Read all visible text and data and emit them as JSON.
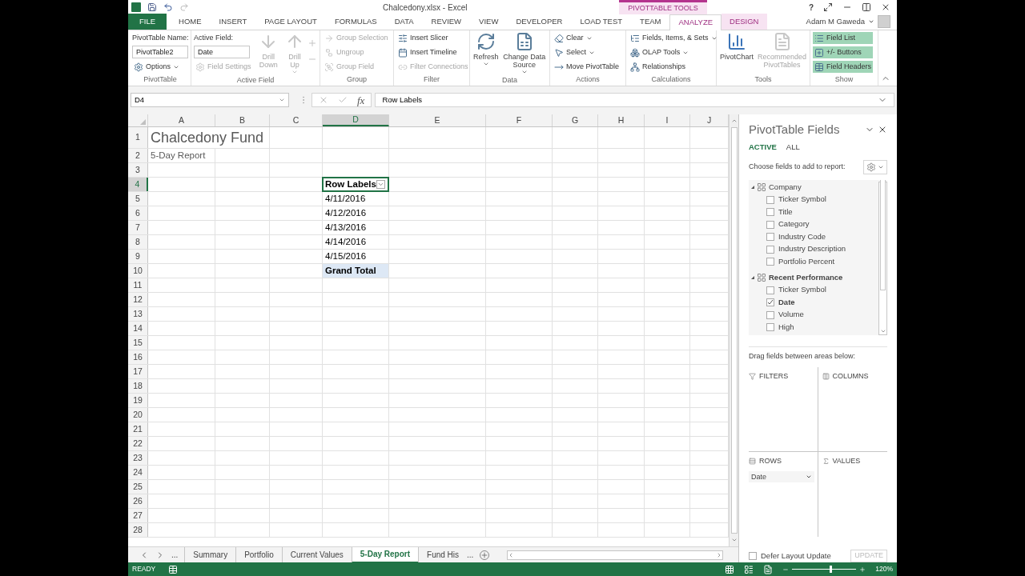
{
  "title_bar": {
    "title": "Chalcedony.xlsx - Excel",
    "contextual_tab_group": "PIVOTTABLE TOOLS",
    "help": "?",
    "user": "Adam M Gaweda"
  },
  "ribbon_tabs": [
    {
      "label": "FILE",
      "kind": "file",
      "selected": false
    },
    {
      "label": "HOME",
      "kind": "tab",
      "selected": false
    },
    {
      "label": "INSERT",
      "kind": "tab",
      "selected": false
    },
    {
      "label": "PAGE LAYOUT",
      "kind": "tab",
      "selected": false
    },
    {
      "label": "FORMULAS",
      "kind": "tab",
      "selected": false
    },
    {
      "label": "DATA",
      "kind": "tab",
      "selected": false
    },
    {
      "label": "REVIEW",
      "kind": "tab",
      "selected": false
    },
    {
      "label": "VIEW",
      "kind": "tab",
      "selected": false
    },
    {
      "label": "DEVELOPER",
      "kind": "tab",
      "selected": false
    },
    {
      "label": "LOAD TEST",
      "kind": "tab",
      "selected": false
    },
    {
      "label": "TEAM",
      "kind": "tab",
      "selected": false
    },
    {
      "label": "ANALYZE",
      "kind": "contextual",
      "selected": true
    },
    {
      "label": "DESIGN",
      "kind": "contextual",
      "selected": false
    }
  ],
  "ribbon_groups": [
    {
      "label": "PivotTable",
      "items": [
        {
          "kind": "caption",
          "label": "PivotTable Name:"
        },
        {
          "kind": "field",
          "value": "PivotTable2"
        },
        {
          "kind": "small",
          "label": "Options",
          "disabled": false,
          "dropdown": true,
          "on": false
        }
      ]
    },
    {
      "label": "Active Field",
      "items": [
        {
          "kind": "caption",
          "label": "Active Field:"
        },
        {
          "kind": "field",
          "value": "Date"
        },
        {
          "kind": "small",
          "label": "Field Settings",
          "disabled": true,
          "dropdown": false,
          "on": false
        },
        {
          "kind": "large",
          "label": "Drill Down",
          "disabled": true,
          "dropdown": false
        },
        {
          "kind": "large",
          "label": "Drill Up",
          "disabled": true,
          "dropdown": true
        },
        {
          "kind": "tiny",
          "disabled": true
        }
      ]
    },
    {
      "label": "Group",
      "items": [
        {
          "kind": "small",
          "label": "Group Selection",
          "disabled": true,
          "dropdown": false,
          "on": false
        },
        {
          "kind": "small",
          "label": "Ungroup",
          "disabled": true,
          "dropdown": false,
          "on": false
        },
        {
          "kind": "small",
          "label": "Group Field",
          "disabled": true,
          "dropdown": false,
          "on": false
        }
      ]
    },
    {
      "label": "Filter",
      "items": [
        {
          "kind": "small",
          "label": "Insert Slicer",
          "disabled": false,
          "dropdown": false,
          "on": false
        },
        {
          "kind": "small",
          "label": "Insert Timeline",
          "disabled": false,
          "dropdown": false,
          "on": false
        },
        {
          "kind": "small",
          "label": "Filter Connections",
          "disabled": true,
          "dropdown": false,
          "on": false
        }
      ]
    },
    {
      "label": "Data",
      "items": [
        {
          "kind": "large",
          "label": "Refresh",
          "disabled": false,
          "dropdown": true
        },
        {
          "kind": "large",
          "label": "Change Data Source",
          "disabled": false,
          "dropdown": true
        }
      ]
    },
    {
      "label": "Actions",
      "items": [
        {
          "kind": "small",
          "label": "Clear",
          "disabled": false,
          "dropdown": true,
          "on": false
        },
        {
          "kind": "small",
          "label": "Select",
          "disabled": false,
          "dropdown": true,
          "on": false
        },
        {
          "kind": "small",
          "label": "Move PivotTable",
          "disabled": false,
          "dropdown": false,
          "on": false
        }
      ]
    },
    {
      "label": "Calculations",
      "items": [
        {
          "kind": "small",
          "label": "Fields, Items, & Sets",
          "disabled": false,
          "dropdown": true,
          "on": false
        },
        {
          "kind": "small",
          "label": "OLAP Tools",
          "disabled": false,
          "dropdown": true,
          "on": false
        },
        {
          "kind": "small",
          "label": "Relationships",
          "disabled": false,
          "dropdown": false,
          "on": false
        }
      ]
    },
    {
      "label": "Tools",
      "items": [
        {
          "kind": "large",
          "label": "PivotChart",
          "disabled": false,
          "dropdown": false
        },
        {
          "kind": "large",
          "label": "Recommended PivotTables",
          "disabled": true,
          "dropdown": false
        }
      ]
    },
    {
      "label": "Show",
      "items": [
        {
          "kind": "small",
          "label": "Field List",
          "disabled": false,
          "dropdown": false,
          "on": true
        },
        {
          "kind": "small",
          "label": "+/- Buttons",
          "disabled": false,
          "dropdown": false,
          "on": true
        },
        {
          "kind": "small",
          "label": "Field Headers",
          "disabled": false,
          "dropdown": false,
          "on": true
        }
      ]
    }
  ],
  "formula_bar": {
    "name_box": "D4",
    "function_button": "fx",
    "formula": "Row Labels"
  },
  "sheet": {
    "columns": [
      {
        "label": "A",
        "selected": false
      },
      {
        "label": "B",
        "selected": false
      },
      {
        "label": "C",
        "selected": false
      },
      {
        "label": "D",
        "selected": true
      },
      {
        "label": "E",
        "selected": false
      },
      {
        "label": "F",
        "selected": false
      },
      {
        "label": "G",
        "selected": false
      },
      {
        "label": "H",
        "selected": false
      },
      {
        "label": "I",
        "selected": false
      },
      {
        "label": "J",
        "selected": false
      }
    ],
    "rows": [
      {
        "number": "1",
        "selected": false,
        "cells": [
          {
            "kind": "title",
            "text": "Chalcedony Fund"
          }
        ]
      },
      {
        "number": "2",
        "selected": false,
        "cells": [
          {
            "kind": "subtitle",
            "text": "5-Day Report"
          }
        ]
      },
      {
        "number": "3",
        "selected": false,
        "cells": []
      },
      {
        "number": "4",
        "selected": true,
        "cells": [
          {
            "kind": "pivot_header",
            "text": "Row Labels"
          }
        ]
      },
      {
        "number": "5",
        "selected": false,
        "cells": [
          {
            "kind": "pivot_item",
            "text": "4/11/2016"
          }
        ]
      },
      {
        "number": "6",
        "selected": false,
        "cells": [
          {
            "kind": "pivot_item",
            "text": "4/12/2016"
          }
        ]
      },
      {
        "number": "7",
        "selected": false,
        "cells": [
          {
            "kind": "pivot_item",
            "text": "4/13/2016"
          }
        ]
      },
      {
        "number": "8",
        "selected": false,
        "cells": [
          {
            "kind": "pivot_item",
            "text": "4/14/2016"
          }
        ]
      },
      {
        "number": "9",
        "selected": false,
        "cells": [
          {
            "kind": "pivot_item",
            "text": "4/15/2016"
          }
        ]
      },
      {
        "number": "10",
        "selected": false,
        "cells": [
          {
            "kind": "pivot_total",
            "text": "Grand Total"
          }
        ]
      },
      {
        "number": "11",
        "selected": false,
        "cells": []
      },
      {
        "number": "12",
        "selected": false,
        "cells": []
      },
      {
        "number": "13",
        "selected": false,
        "cells": []
      },
      {
        "number": "14",
        "selected": false,
        "cells": []
      },
      {
        "number": "15",
        "selected": false,
        "cells": []
      },
      {
        "number": "16",
        "selected": false,
        "cells": []
      },
      {
        "number": "17",
        "selected": false,
        "cells": []
      },
      {
        "number": "18",
        "selected": false,
        "cells": []
      },
      {
        "number": "19",
        "selected": false,
        "cells": []
      },
      {
        "number": "20",
        "selected": false,
        "cells": []
      },
      {
        "number": "21",
        "selected": false,
        "cells": []
      },
      {
        "number": "22",
        "selected": false,
        "cells": []
      },
      {
        "number": "23",
        "selected": false,
        "cells": []
      },
      {
        "number": "24",
        "selected": false,
        "cells": []
      },
      {
        "number": "25",
        "selected": false,
        "cells": []
      },
      {
        "number": "26",
        "selected": false,
        "cells": []
      },
      {
        "number": "27",
        "selected": false,
        "cells": []
      },
      {
        "number": "28",
        "selected": false,
        "cells": []
      }
    ]
  },
  "sheet_tabs": {
    "more_left": "...",
    "tabs": [
      {
        "label": "Summary",
        "selected": false
      },
      {
        "label": "Portfolio",
        "selected": false
      },
      {
        "label": "Current Values",
        "selected": false
      },
      {
        "label": "5-Day Report",
        "selected": true
      },
      {
        "label": "Fund His",
        "selected": false
      }
    ],
    "more_right": "..."
  },
  "pivot_pane": {
    "title": "PivotTable Fields",
    "views": [
      {
        "label": "ACTIVE",
        "selected": true
      },
      {
        "label": "ALL",
        "selected": false
      }
    ],
    "choose_label": "Choose fields to add to report:",
    "tables": [
      {
        "name": "Company",
        "expanded": true,
        "children": [
          {
            "label": "Ticker Symbol",
            "checked": false
          },
          {
            "label": "Title",
            "checked": false
          },
          {
            "label": "Category",
            "checked": false
          },
          {
            "label": "Industry Code",
            "checked": false
          },
          {
            "label": "Industry Description",
            "checked": false
          },
          {
            "label": "Portfolio Percent",
            "checked": false
          }
        ]
      },
      {
        "name": "Recent Performance",
        "expanded": true,
        "children": [
          {
            "label": "Ticker Symbol",
            "checked": false
          },
          {
            "label": "Date",
            "checked": true
          },
          {
            "label": "Volume",
            "checked": false
          },
          {
            "label": "High",
            "checked": false
          }
        ]
      }
    ],
    "drag_label": "Drag fields between areas below:",
    "areas": [
      {
        "kind": "filters",
        "label": "FILTERS"
      },
      {
        "kind": "columns",
        "label": "COLUMNS"
      },
      {
        "kind": "rows",
        "label": "ROWS",
        "fields": [
          "Date"
        ]
      },
      {
        "kind": "values",
        "label": "VALUES"
      }
    ],
    "defer": {
      "label": "Defer Layout Update",
      "checked": false
    },
    "update_button": "UPDATE"
  },
  "status_bar": {
    "mode": "READY",
    "zoom": {
      "level": 0.58,
      "reading": "120%"
    }
  }
}
